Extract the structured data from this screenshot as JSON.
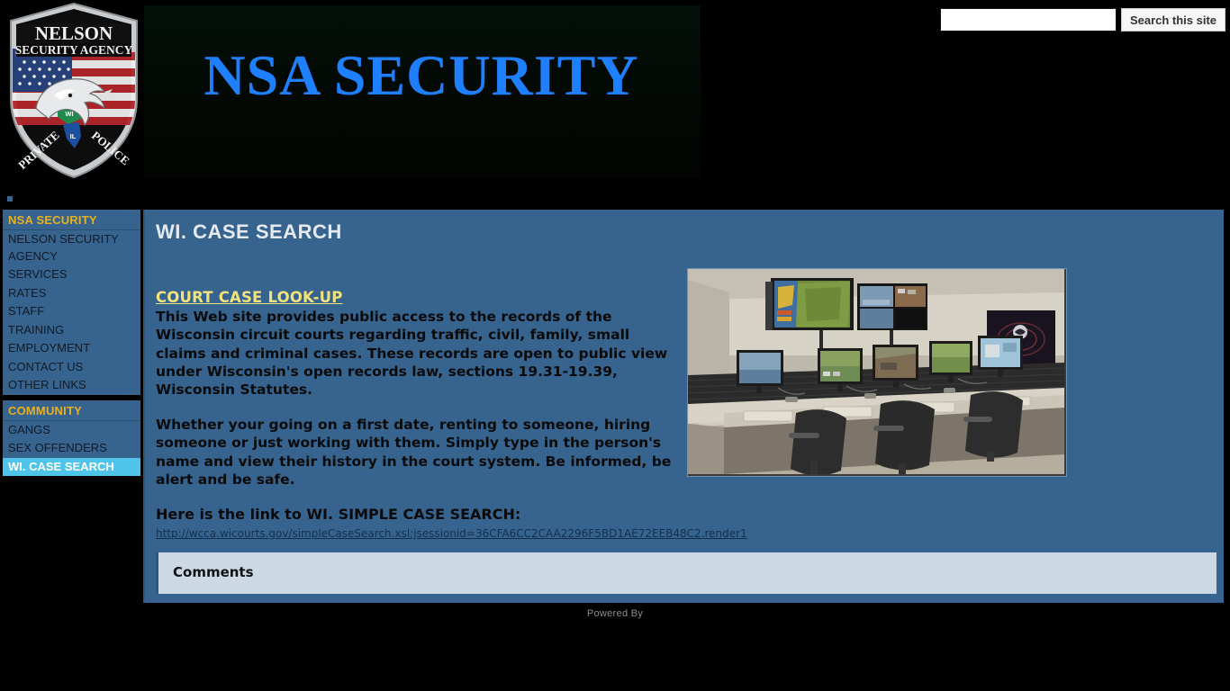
{
  "header": {
    "banner_title": "NSA SECURITY",
    "logo": {
      "name": "nelson-security-agency-badge",
      "top_text": "NELSON",
      "sub_text": "SECURITY AGENCY",
      "left_text": "PRIVATE",
      "right_text": "POLICE",
      "state_wi": "WI",
      "state_il": "IL"
    },
    "search": {
      "value": "",
      "placeholder": "",
      "button_label": "Search this site"
    }
  },
  "sidebar": {
    "sections": [
      {
        "title": "NSA SECURITY",
        "items": [
          {
            "label": "NELSON SECURITY AGENCY",
            "active": false
          },
          {
            "label": "SERVICES",
            "active": false
          },
          {
            "label": "RATES",
            "active": false
          },
          {
            "label": "STAFF",
            "active": false
          },
          {
            "label": "TRAINING",
            "active": false
          },
          {
            "label": "EMPLOYMENT",
            "active": false
          },
          {
            "label": "CONTACT US",
            "active": false
          },
          {
            "label": "OTHER LINKS",
            "active": false
          }
        ]
      },
      {
        "title": "COMMUNITY",
        "items": [
          {
            "label": "GANGS",
            "active": false
          },
          {
            "label": "SEX OFFENDERS",
            "active": false
          },
          {
            "label": "WI. CASE SEARCH",
            "active": true
          }
        ]
      }
    ]
  },
  "main": {
    "page_title": "WI. CASE SEARCH",
    "lookup_heading": "COURT CASE LOOK-UP",
    "paragraph_1": "This Web site provides public access to the records of the Wisconsin circuit courts regarding traffic, civil, family, small claims and criminal cases. These records are open to public view under Wisconsin's open records law, sections 19.31-19.39, Wisconsin Statutes.",
    "paragraph_2": "Whether your going on a first date, renting to someone, hiring someone or just working with them. Simply type in the person's name and view their history in the court system. Be informed, be alert and be safe.",
    "link_heading": "Here is the link to WI. SIMPLE CASE SEARCH:",
    "link_url": "http://wcca.wicourts.gov/simpleCaseSearch.xsl;jsessionid=36CFA6CC2CAA2296F5BD1AE72EEB48C2.render1",
    "photo_alt": "security-control-room-photo"
  },
  "comments": {
    "label": "Comments"
  },
  "footer": {
    "powered_by": "Powered By"
  },
  "colors": {
    "page_background": "#000000",
    "panel_blue": "#36648f",
    "accent_gold": "#e8b020",
    "active_item": "#4fc3ea",
    "banner_text_blue": "#1e7fff",
    "lookup_heading": "#f2e27a",
    "comments_bg": "#ccd8e4"
  }
}
